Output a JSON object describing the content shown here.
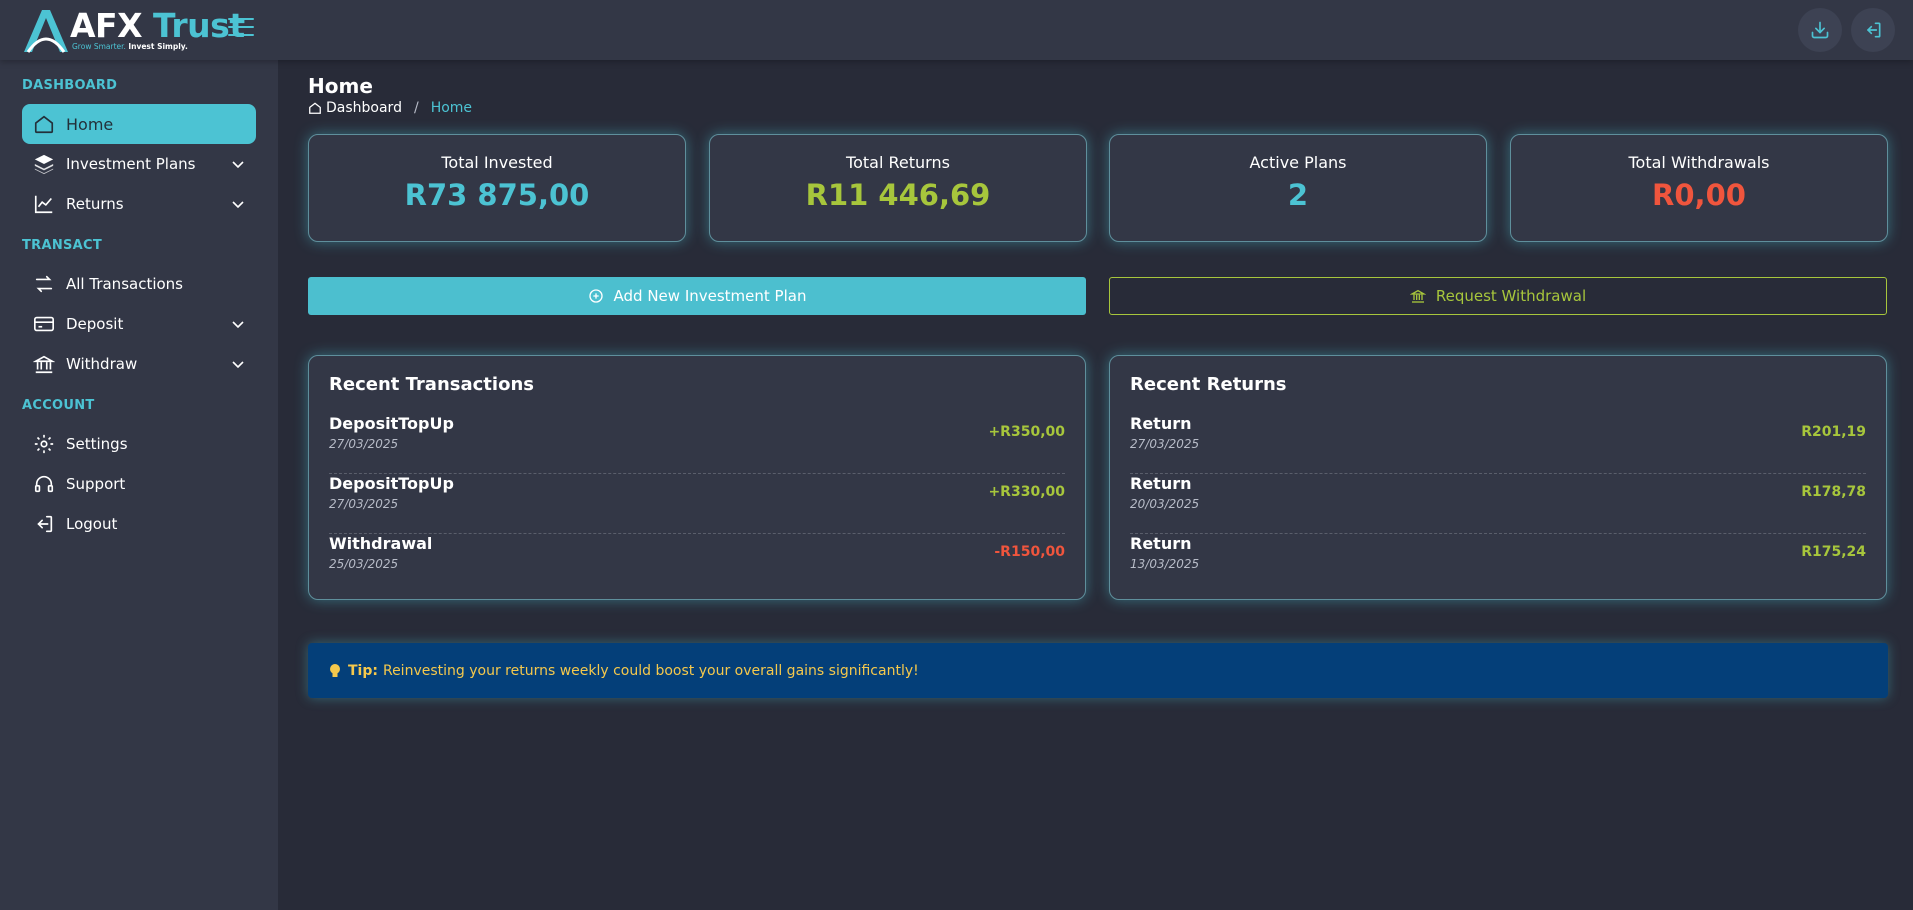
{
  "brand": {
    "name_prefix": "AFX",
    "name_main": " Trust",
    "tagline_a": "Grow Smarter.",
    "tagline_b": "Invest Simply."
  },
  "colors": {
    "accent": "#4cc3d3",
    "positive": "#a7c63c",
    "negative": "#f0553d",
    "tip_bg": "#043f79",
    "tip_text": "#f5c84c"
  },
  "icons": {
    "menu": "hamburger-icon",
    "download": "download-icon",
    "logout": "logout-icon"
  },
  "sidebar": {
    "sections": [
      {
        "label": "DASHBOARD",
        "items": [
          {
            "label": "Home",
            "icon": "home-icon",
            "active": true
          },
          {
            "label": "Investment Plans",
            "icon": "layers-icon",
            "expandable": true
          },
          {
            "label": "Returns",
            "icon": "chart-line-icon",
            "expandable": true
          }
        ]
      },
      {
        "label": "TRANSACT",
        "items": [
          {
            "label": "All Transactions",
            "icon": "swap-arrows-icon"
          },
          {
            "label": "Deposit",
            "icon": "credit-card-icon",
            "expandable": true
          },
          {
            "label": "Withdraw",
            "icon": "bank-icon",
            "expandable": true
          }
        ]
      },
      {
        "label": "ACCOUNT",
        "items": [
          {
            "label": "Settings",
            "icon": "gear-icon"
          },
          {
            "label": "Support",
            "icon": "headset-icon"
          },
          {
            "label": "Logout",
            "icon": "logout-icon"
          }
        ]
      }
    ]
  },
  "page": {
    "title": "Home",
    "breadcrumb": {
      "root": "Dashboard",
      "separator": "/",
      "current": "Home"
    }
  },
  "stats": [
    {
      "label": "Total Invested",
      "value": "R73 875,00",
      "color": "#4cc3d3"
    },
    {
      "label": "Total Returns",
      "value": "R11 446,69",
      "color": "#a7c63c"
    },
    {
      "label": "Active Plans",
      "value": "2",
      "color": "#4cc3d3"
    },
    {
      "label": "Total Withdrawals",
      "value": "R0,00",
      "color": "#f0553d"
    }
  ],
  "actions": {
    "add_plan": "Add New Investment Plan",
    "request_withdrawal": "Request Withdrawal"
  },
  "recent_transactions": {
    "title": "Recent Transactions",
    "rows": [
      {
        "name": "DepositTopUp",
        "date": "27/03/2025",
        "amount": "+R350,00",
        "type": "positive"
      },
      {
        "name": "DepositTopUp",
        "date": "27/03/2025",
        "amount": "+R330,00",
        "type": "positive"
      },
      {
        "name": "Withdrawal",
        "date": "25/03/2025",
        "amount": "-R150,00",
        "type": "negative"
      }
    ]
  },
  "recent_returns": {
    "title": "Recent Returns",
    "rows": [
      {
        "name": "Return",
        "date": "27/03/2025",
        "amount": "R201,19",
        "type": "positive"
      },
      {
        "name": "Return",
        "date": "20/03/2025",
        "amount": "R178,78",
        "type": "positive"
      },
      {
        "name": "Return",
        "date": "13/03/2025",
        "amount": "R175,24",
        "type": "positive"
      }
    ]
  },
  "tip": {
    "label": "Tip:",
    "text": "Reinvesting your returns weekly could boost your overall gains significantly!"
  }
}
